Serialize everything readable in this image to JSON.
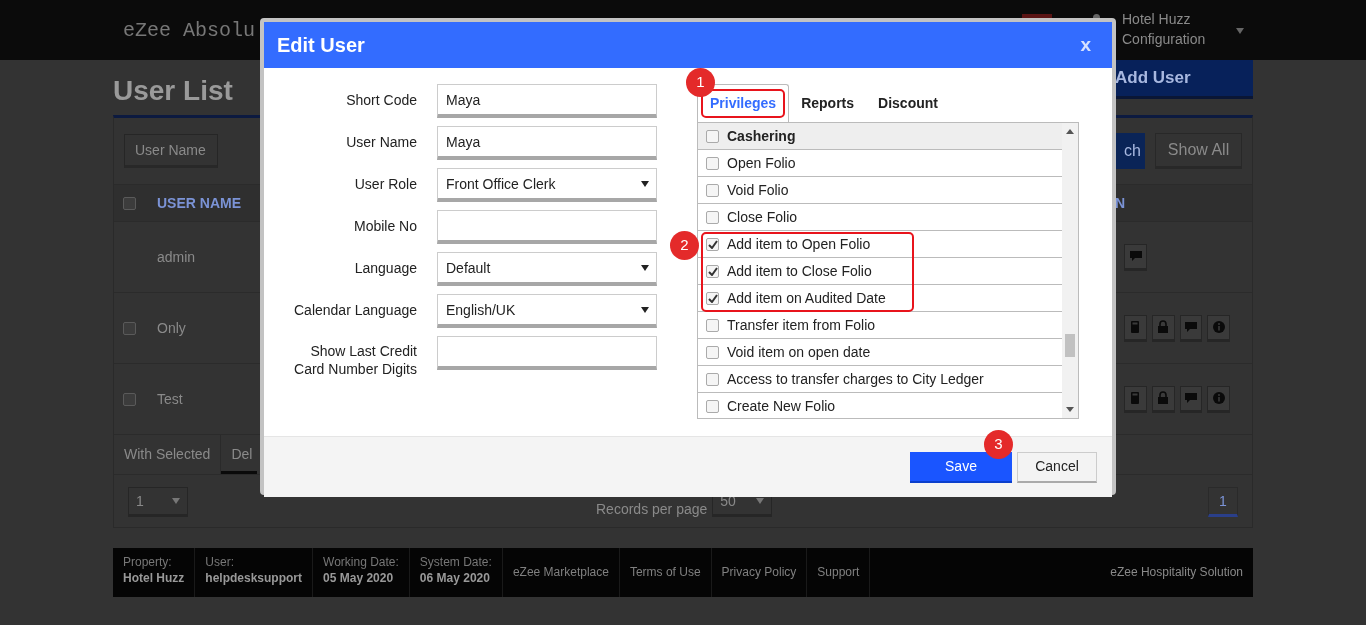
{
  "app": {
    "logo": "eZee Absolu",
    "hotel": "Hotel Huzz",
    "menu": "Configuration"
  },
  "page": {
    "title": "User List",
    "add_button": "Add User"
  },
  "filters": {
    "field_label": "User Name",
    "search_button": "ch",
    "show_all_button": "Show All"
  },
  "table": {
    "column": "USER NAME",
    "last_column": "N",
    "all_selected": false,
    "rows": [
      {
        "name": "admin",
        "kind": "plain",
        "actions": [
          {
            "kind": "chat"
          }
        ]
      },
      {
        "name": "Only",
        "kind": "checkable",
        "checked": false,
        "actions": [
          {
            "kind": "calculator"
          },
          {
            "kind": "lock"
          },
          {
            "kind": "chat"
          },
          {
            "kind": "info"
          }
        ]
      },
      {
        "name": "Test",
        "kind": "checkable",
        "checked": false,
        "actions": [
          {
            "kind": "calculator"
          },
          {
            "kind": "lock"
          },
          {
            "kind": "chat"
          },
          {
            "kind": "info"
          }
        ]
      }
    ]
  },
  "bulk": {
    "label": "With Selected",
    "action": "Del"
  },
  "pagination": {
    "page_select": "1",
    "records_label": "Records per page",
    "per_page": "50",
    "pages": [
      {
        "label": "1",
        "selected": true
      }
    ]
  },
  "footer": {
    "items": [
      {
        "label": "Property:",
        "value": "Hotel Huzz"
      },
      {
        "label": "User:",
        "value": "helpdesksupport"
      },
      {
        "label": "Working Date:",
        "value": "05 May 2020"
      },
      {
        "label": "System Date:",
        "value": "06 May 2020"
      }
    ],
    "links": [
      "eZee Marketplace",
      "Terms of Use",
      "Privacy Policy",
      "Support"
    ],
    "brand": "eZee Hospitality Solution"
  },
  "dialog": {
    "title": "Edit User",
    "close": "x",
    "fields": [
      {
        "label": "Short Code",
        "kind": "text",
        "value": "Maya"
      },
      {
        "label": "User Name",
        "kind": "text",
        "value": "Maya"
      },
      {
        "label": "User Role",
        "kind": "select",
        "value": "Front Office Clerk"
      },
      {
        "label": "Mobile No",
        "kind": "text"
      },
      {
        "label": "Language",
        "kind": "select",
        "value": "Default"
      },
      {
        "label": "Calendar Language",
        "kind": "select",
        "value": "English/UK"
      },
      {
        "label": "Show Last Credit Card Number Digits",
        "kind": "text"
      }
    ],
    "tabs": [
      {
        "label": "Privileges",
        "selected": true,
        "marker": "1"
      },
      {
        "label": "Reports",
        "selected": false
      },
      {
        "label": "Discount",
        "selected": false
      }
    ],
    "privileges": [
      {
        "label": "Cashering",
        "kind": "group",
        "checked": false
      },
      {
        "label": "Open Folio",
        "kind": "item",
        "checked": false
      },
      {
        "label": "Void Folio",
        "kind": "item",
        "checked": false
      },
      {
        "label": "Close Folio",
        "kind": "item",
        "checked": false
      },
      {
        "kind": "highlight",
        "marker": "2",
        "children": [
          {
            "label": "Add item to Open Folio",
            "kind": "item",
            "checked": true
          },
          {
            "label": "Add item to Close Folio",
            "kind": "item",
            "checked": true
          },
          {
            "label": "Add item on Audited Date",
            "kind": "item",
            "checked": true
          }
        ]
      },
      {
        "label": "Transfer item from Folio",
        "kind": "item",
        "checked": false
      },
      {
        "label": "Void item on open date",
        "kind": "item",
        "checked": false
      },
      {
        "label": "Access to transfer charges to City Ledger",
        "kind": "item",
        "checked": false
      },
      {
        "label": "Create New Folio",
        "kind": "item",
        "checked": false
      }
    ],
    "buttons": [
      {
        "label": "Save",
        "kind": "primary",
        "marker": "3"
      },
      {
        "label": "Cancel",
        "kind": "secondary"
      }
    ]
  }
}
